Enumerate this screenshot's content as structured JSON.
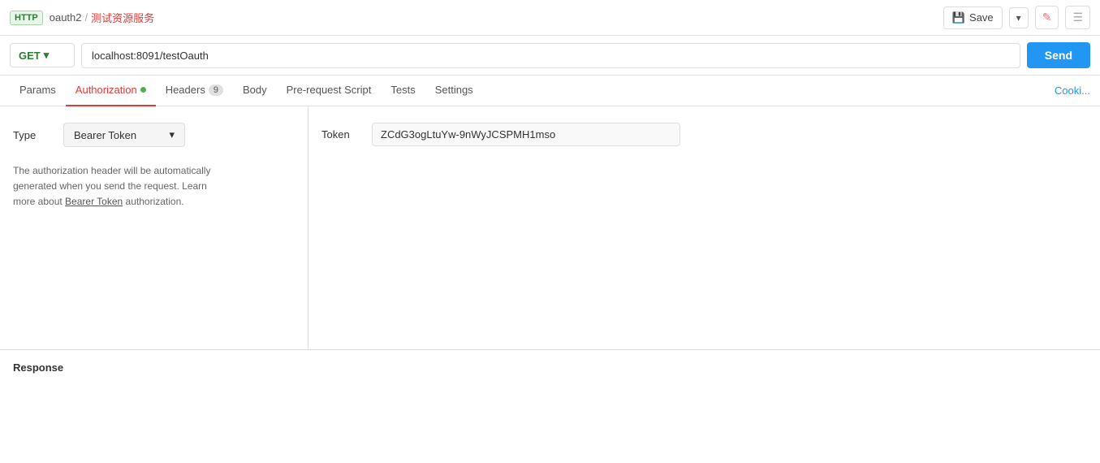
{
  "topbar": {
    "http_badge": "HTTP",
    "breadcrumb_parent": "oauth2",
    "breadcrumb_separator": "/",
    "breadcrumb_current": "测试资源服务",
    "save_label": "Save",
    "edit_icon": "✎",
    "notes_icon": "☰",
    "chevron_icon": "▾"
  },
  "urlbar": {
    "method": "GET",
    "method_chevron": "▾",
    "url": "localhost:8091/testOauth",
    "send_label": "Send"
  },
  "tabs": {
    "items": [
      {
        "id": "params",
        "label": "Params",
        "active": false,
        "has_dot": false,
        "badge": null
      },
      {
        "id": "authorization",
        "label": "Authorization",
        "active": true,
        "has_dot": true,
        "badge": null
      },
      {
        "id": "headers",
        "label": "Headers",
        "active": false,
        "has_dot": false,
        "badge": "9"
      },
      {
        "id": "body",
        "label": "Body",
        "active": false,
        "has_dot": false,
        "badge": null
      },
      {
        "id": "pre-request",
        "label": "Pre-request Script",
        "active": false,
        "has_dot": false,
        "badge": null
      },
      {
        "id": "tests",
        "label": "Tests",
        "active": false,
        "has_dot": false,
        "badge": null
      },
      {
        "id": "settings",
        "label": "Settings",
        "active": false,
        "has_dot": false,
        "badge": null
      }
    ],
    "cookies_label": "Cooki..."
  },
  "auth": {
    "type_label": "Type",
    "type_value": "Bearer Token",
    "type_chevron": "▾",
    "description_line1": "The authorization header will be automatically",
    "description_line2": "generated when you send the request. Learn",
    "description_line3": "more about ",
    "description_link": "Bearer Token",
    "description_line4": " authorization.",
    "token_label": "Token",
    "token_value": "ZCdG3ogLtuYw-9nWyJCSPMH1mso"
  },
  "response": {
    "title": "Response"
  }
}
